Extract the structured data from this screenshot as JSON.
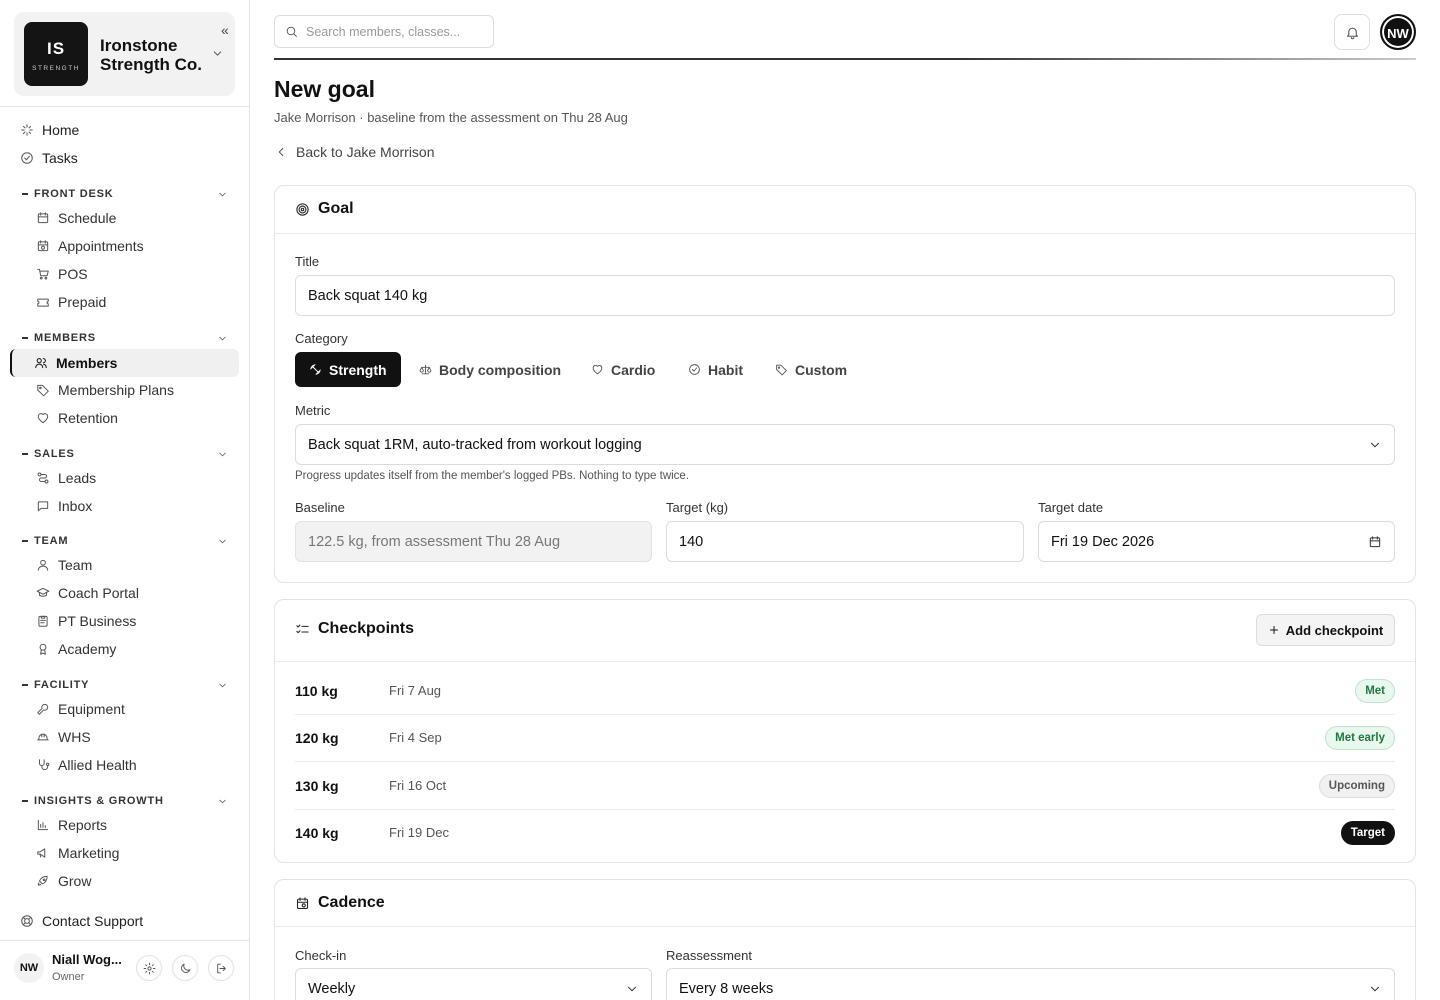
{
  "brand": {
    "logo_big": "IS",
    "logo_small": "STRENGTH",
    "name": "Ironstone Strength Co.",
    "collapse_glyph": "«"
  },
  "nav": {
    "home": "Home",
    "tasks": "Tasks",
    "front_desk": {
      "title": "FRONT DESK",
      "items": [
        "Schedule",
        "Appointments",
        "POS",
        "Prepaid"
      ]
    },
    "members": {
      "title": "MEMBERS",
      "items": [
        "Members",
        "Membership Plans",
        "Retention"
      ],
      "active": "Members"
    },
    "sales": {
      "title": "SALES",
      "items": [
        "Leads",
        "Inbox"
      ]
    },
    "team": {
      "title": "TEAM",
      "items": [
        "Team",
        "Coach Portal",
        "PT Business",
        "Academy"
      ]
    },
    "facility": {
      "title": "FACILITY",
      "items": [
        "Equipment",
        "WHS",
        "Allied Health"
      ]
    },
    "insights": {
      "title": "INSIGHTS & GROWTH",
      "items": [
        "Reports",
        "Marketing",
        "Grow"
      ]
    },
    "contact_support": "Contact Support"
  },
  "user": {
    "initials": "NW",
    "name": "Niall Wog...",
    "role": "Owner"
  },
  "topbar": {
    "search_placeholder": "Search members, classes...",
    "avatar_initials": "NW"
  },
  "page": {
    "title": "New goal",
    "subtitle": "Jake Morrison · baseline from the assessment on Thu 28 Aug",
    "back_link": "Back to Jake Morrison"
  },
  "goal": {
    "heading": "Goal",
    "title_label": "Title",
    "title_value": "Back squat 140 kg",
    "category_label": "Category",
    "categories": [
      "Strength",
      "Body composition",
      "Cardio",
      "Habit",
      "Custom"
    ],
    "category_selected": "Strength",
    "metric_label": "Metric",
    "metric_value": "Back squat 1RM, auto-tracked from workout logging",
    "metric_hint": "Progress updates itself from the member's logged PBs. Nothing to type twice.",
    "baseline_label": "Baseline",
    "baseline_value": "122.5 kg, from assessment Thu 28 Aug",
    "target_label": "Target (kg)",
    "target_value": "140",
    "target_date_label": "Target date",
    "target_date_value": "Fri 19 Dec 2026"
  },
  "checkpoints": {
    "heading": "Checkpoints",
    "add_label": "Add checkpoint",
    "rows": [
      {
        "weight": "110 kg",
        "date": "Fri 7 Aug",
        "status": "Met"
      },
      {
        "weight": "120 kg",
        "date": "Fri 4 Sep",
        "status": "Met early"
      },
      {
        "weight": "130 kg",
        "date": "Fri 16 Oct",
        "status": "Upcoming"
      },
      {
        "weight": "140 kg",
        "date": "Fri 19 Dec",
        "status": "Target"
      }
    ]
  },
  "cadence": {
    "heading": "Cadence",
    "checkin_label": "Check-in",
    "checkin_value": "Weekly",
    "reassessment_label": "Reassessment",
    "reassessment_value": "Every 8 weeks"
  },
  "colors": {
    "accent": "#111111",
    "success_bg": "#e9f8ee",
    "success_text": "#1f7a3e",
    "muted_bg": "#f2f2f2"
  }
}
